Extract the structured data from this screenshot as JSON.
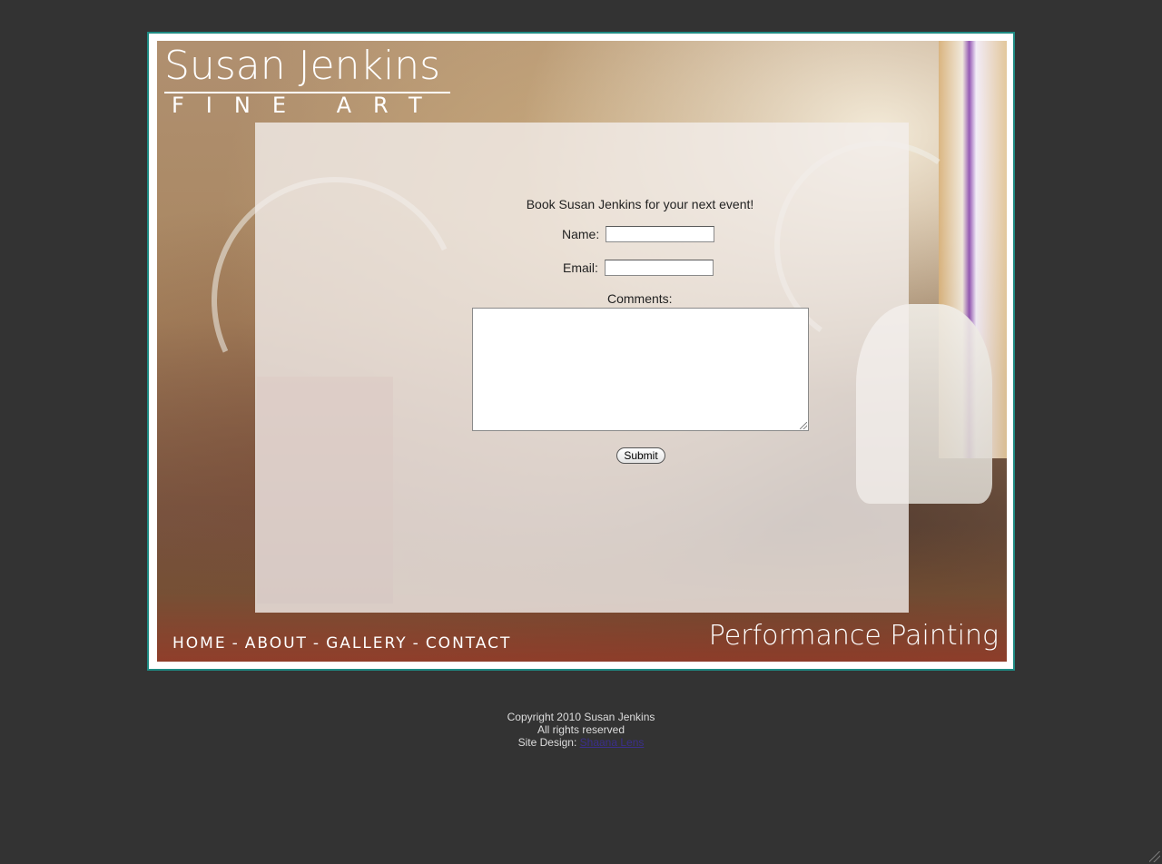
{
  "header": {
    "logo_name": "Susan Jenkins",
    "logo_sub": "FINE ART"
  },
  "form": {
    "heading": "Book Susan Jenkins for your next event!",
    "name_label": "Name:",
    "name_value": "",
    "email_label": "Email:",
    "email_value": "",
    "comments_label": "Comments:",
    "comments_value": "",
    "submit_label": "Submit"
  },
  "nav": {
    "items": [
      {
        "label": "HOME"
      },
      {
        "label": "ABOUT"
      },
      {
        "label": "GALLERY"
      },
      {
        "label": "CONTACT"
      }
    ],
    "separator": "-"
  },
  "tagline": "Performance Painting",
  "footer": {
    "copyright": "Copyright 2010 Susan Jenkins",
    "rights": "All rights reserved",
    "design_label": "Site Design:",
    "design_link": "Shaana Lens"
  },
  "colors": {
    "page_background": "#333333",
    "frame_border": "#1f8a83",
    "panel_overlay": "#f2eeeb",
    "footer_link": "#3b2f8a"
  },
  "icons": {
    "textarea_resize": "resize-grip-icon",
    "window_resize": "corner-grip-icon"
  }
}
